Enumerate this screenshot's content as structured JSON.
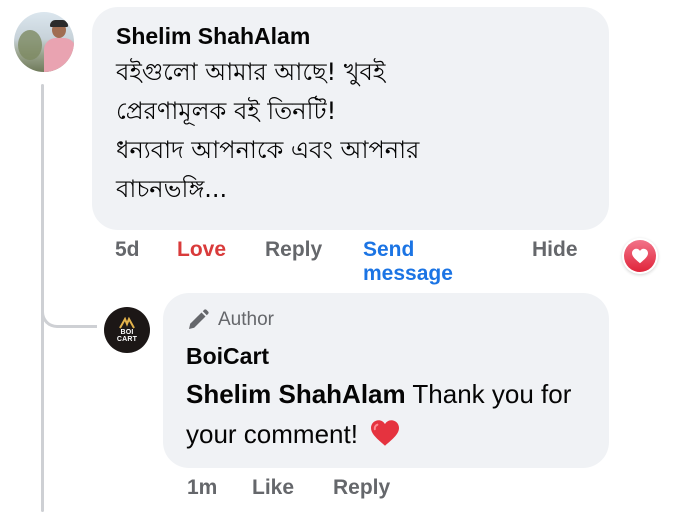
{
  "comment": {
    "author": "Shelim ShahAlam",
    "text": "বইগুলো আমার আছে! খুবই\nপ্রেরণামূলক বই তিনটি!\nধন্যবাদ আপনাকে এবং আপনার\nবাচনভঙ্গি...",
    "avatar_icon": "user-photo",
    "actions": {
      "time": "5d",
      "love": "Love",
      "reply": "Reply",
      "send_message_line1": "Send",
      "send_message_line2": "message",
      "hide": "Hide"
    },
    "reaction_icon": "love-heart-icon",
    "colors": {
      "bubble": "#f0f2f5",
      "love": "#d93b3b",
      "link": "#1b74e4",
      "muted": "#65676b"
    }
  },
  "reply": {
    "badge": "Author",
    "badge_icon": "pencil-icon",
    "author": "BoiCart",
    "avatar_logo_line1": "BOI",
    "avatar_logo_line2": "CART",
    "mention": "Shelim ShahAlam",
    "text": "Thank you for your comment!",
    "emoji_icon": "red-heart-icon",
    "actions": {
      "time": "1m",
      "like": "Like",
      "reply": "Reply"
    }
  }
}
